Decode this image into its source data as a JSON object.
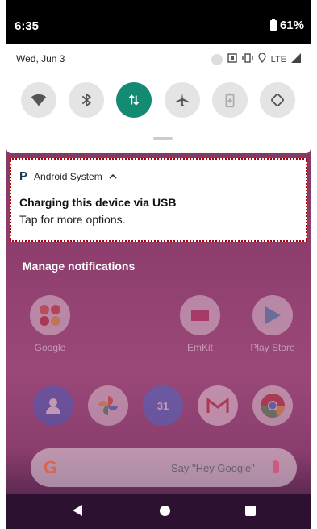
{
  "status_bar": {
    "time": "6:35",
    "battery": "61%"
  },
  "quick_settings": {
    "date": "Wed, Jun 3",
    "network": "LTE",
    "tiles": [
      {
        "name": "wifi-icon",
        "active": false
      },
      {
        "name": "bluetooth-icon",
        "active": false
      },
      {
        "name": "mobile-data-icon",
        "active": true
      },
      {
        "name": "airplane-icon",
        "active": false
      },
      {
        "name": "battery-saver-icon",
        "active": false
      },
      {
        "name": "auto-rotate-icon",
        "active": false
      }
    ]
  },
  "notification": {
    "app": "Android System",
    "app_letter": "P",
    "title": "Charging this device via USB",
    "text": "Tap for more options."
  },
  "manage_label": "Manage notifications",
  "home": {
    "apps": [
      {
        "label": "Google"
      },
      {
        "label": "EmKit"
      },
      {
        "label": "Play Store"
      }
    ],
    "calendar_day": "31",
    "search_hint": "Say \"Hey Google\""
  },
  "colors": {
    "accent": "#138a72",
    "highlight": "#b00000"
  }
}
